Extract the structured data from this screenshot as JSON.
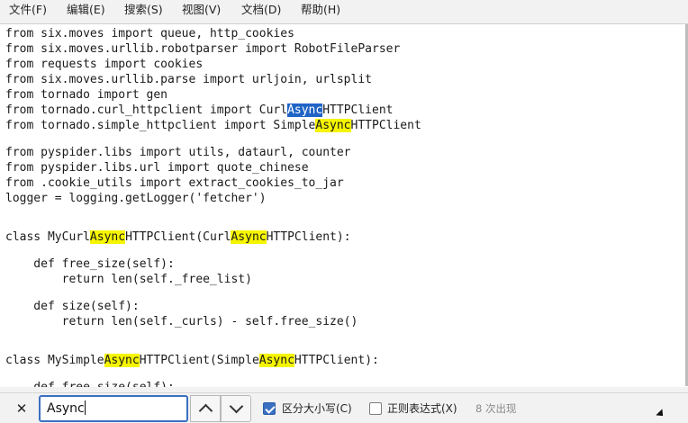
{
  "menubar": {
    "items": [
      "文件(F)",
      "编辑(E)",
      "搜索(S)",
      "视图(V)",
      "文档(D)",
      "帮助(H)"
    ]
  },
  "editor": {
    "lines": [
      [
        {
          "t": "from six.moves import queue, http_cookies"
        }
      ],
      [
        {
          "t": "from six.moves.urllib.robotparser import RobotFileParser"
        }
      ],
      [
        {
          "t": "from requests import cookies"
        }
      ],
      [
        {
          "t": "from six.moves.urllib.parse import urljoin, urlsplit"
        }
      ],
      [
        {
          "t": "from tornado import gen"
        }
      ],
      [
        {
          "t": "from tornado.curl_httpclient import Curl"
        },
        {
          "t": "Async",
          "k": "sel"
        },
        {
          "t": "HTTPClient"
        }
      ],
      [
        {
          "t": "from tornado.simple_httpclient import Simple"
        },
        {
          "t": "Async",
          "k": "hl"
        },
        {
          "t": "HTTPClient"
        }
      ],
      [
        {
          "t": "from pyspider.libs import utils, dataurl, counter"
        }
      ],
      [
        {
          "t": "from pyspider.libs.url import quote_chinese"
        }
      ],
      [
        {
          "t": "from .cookie_utils import extract_cookies_to_jar"
        }
      ],
      [
        {
          "t": "logger = logging.getLogger('fetcher')"
        }
      ],
      [
        {
          "t": "class MyCurl"
        },
        {
          "t": "Async",
          "k": "hl"
        },
        {
          "t": "HTTPClient(Curl"
        },
        {
          "t": "Async",
          "k": "hl"
        },
        {
          "t": "HTTPClient):"
        }
      ],
      [
        {
          "t": "    def free_size(self):"
        }
      ],
      [
        {
          "t": "        return len(self._free_list)"
        }
      ],
      [
        {
          "t": "    def size(self):"
        }
      ],
      [
        {
          "t": "        return len(self._curls) - self.free_size()"
        }
      ],
      [
        {
          "t": "class MySimple"
        },
        {
          "t": "Async",
          "k": "hl"
        },
        {
          "t": "HTTPClient(Simple"
        },
        {
          "t": "Async",
          "k": "hl"
        },
        {
          "t": "HTTPClient):"
        }
      ],
      [
        {
          "t": "    def free_size(self):"
        }
      ]
    ]
  },
  "findbar": {
    "close_glyph": "✕",
    "search_value": "Async",
    "match_case_label": "区分大小写(C)",
    "match_case_checked": true,
    "regex_label": "正则表达式(X)",
    "regex_checked": false,
    "match_count": "8 次出现"
  },
  "colors": {
    "highlight": "#f6f500",
    "selection": "#1f63c6",
    "accent": "#3a70c2"
  }
}
